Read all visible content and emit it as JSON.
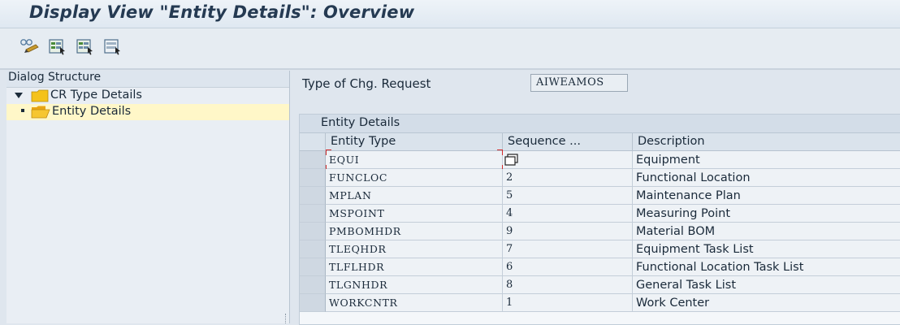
{
  "window": {
    "title": "Display View \"Entity Details\": Overview"
  },
  "toolbar": {
    "buttons": [
      {
        "icon": "display-change-icon"
      },
      {
        "icon": "select-all-icon"
      },
      {
        "icon": "select-block-icon"
      },
      {
        "icon": "deselect-all-icon"
      }
    ]
  },
  "dialog_structure": {
    "heading": "Dialog Structure",
    "items": [
      {
        "label": "CR Type Details",
        "icon": "folder-icon",
        "expanded": true
      },
      {
        "label": "Entity Details",
        "icon": "open-folder-icon",
        "selected": true
      }
    ]
  },
  "header_field": {
    "label": "Type of Chg. Request",
    "value": "AIWEAMOS"
  },
  "table": {
    "title": "Entity Details",
    "columns": [
      "Entity Type",
      "Sequence ...",
      "Description"
    ],
    "rows": [
      {
        "entity_type": "EQUI",
        "sequence": "",
        "description": "Equipment"
      },
      {
        "entity_type": "FUNCLOC",
        "sequence": "2",
        "description": "Functional Location"
      },
      {
        "entity_type": "MPLAN",
        "sequence": "5",
        "description": "Maintenance Plan"
      },
      {
        "entity_type": "MSPOINT",
        "sequence": "4",
        "description": "Measuring Point"
      },
      {
        "entity_type": "PMBOMHDR",
        "sequence": "9",
        "description": "Material BOM"
      },
      {
        "entity_type": "TLEQHDR",
        "sequence": "7",
        "description": "Equipment Task List"
      },
      {
        "entity_type": "TLFLHDR",
        "sequence": "6",
        "description": "Functional Location Task List"
      },
      {
        "entity_type": "TLGNHDR",
        "sequence": "8",
        "description": "General Task List"
      },
      {
        "entity_type": "WORKCNTR",
        "sequence": "1",
        "description": "Work Center"
      }
    ]
  },
  "colors": {
    "folder": "#f4c21b",
    "selected_tree_row": "#fff7c8",
    "cursor_corner": "#d22a2a"
  }
}
